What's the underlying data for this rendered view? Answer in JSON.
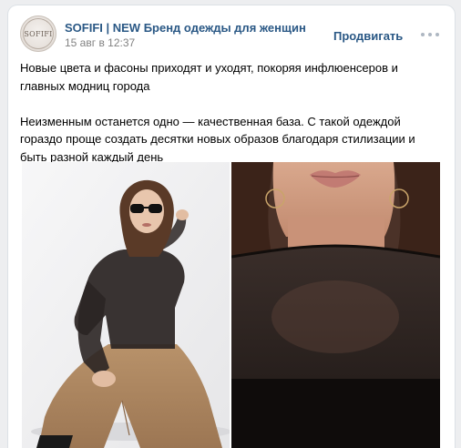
{
  "post": {
    "author": "SOFIFI | NEW Бренд одежды для женщин",
    "date": "15 авг в 12:37",
    "promote_label": "Продвигать",
    "avatar_text": "SOFIFI",
    "paragraphs": [
      "Новые цвета и фасоны приходят и уходят, покоряя инфлюенсеров и главных модниц города",
      "Неизменным останется одно — качественная база. С такой одеждой гораздо проще создать десятки новых образов благодаря стилизации и быть разной каждый день"
    ]
  },
  "icons": {
    "more": "more-horizontal-icon"
  },
  "photos": [
    {
      "description": "woman-in-sunglasses-sheer-black-top-beige-trousers"
    },
    {
      "description": "close-up-sheer-black-top-neckline"
    }
  ],
  "colors": {
    "link": "#2a5885",
    "meta": "#828282",
    "background": "#edeef0"
  }
}
